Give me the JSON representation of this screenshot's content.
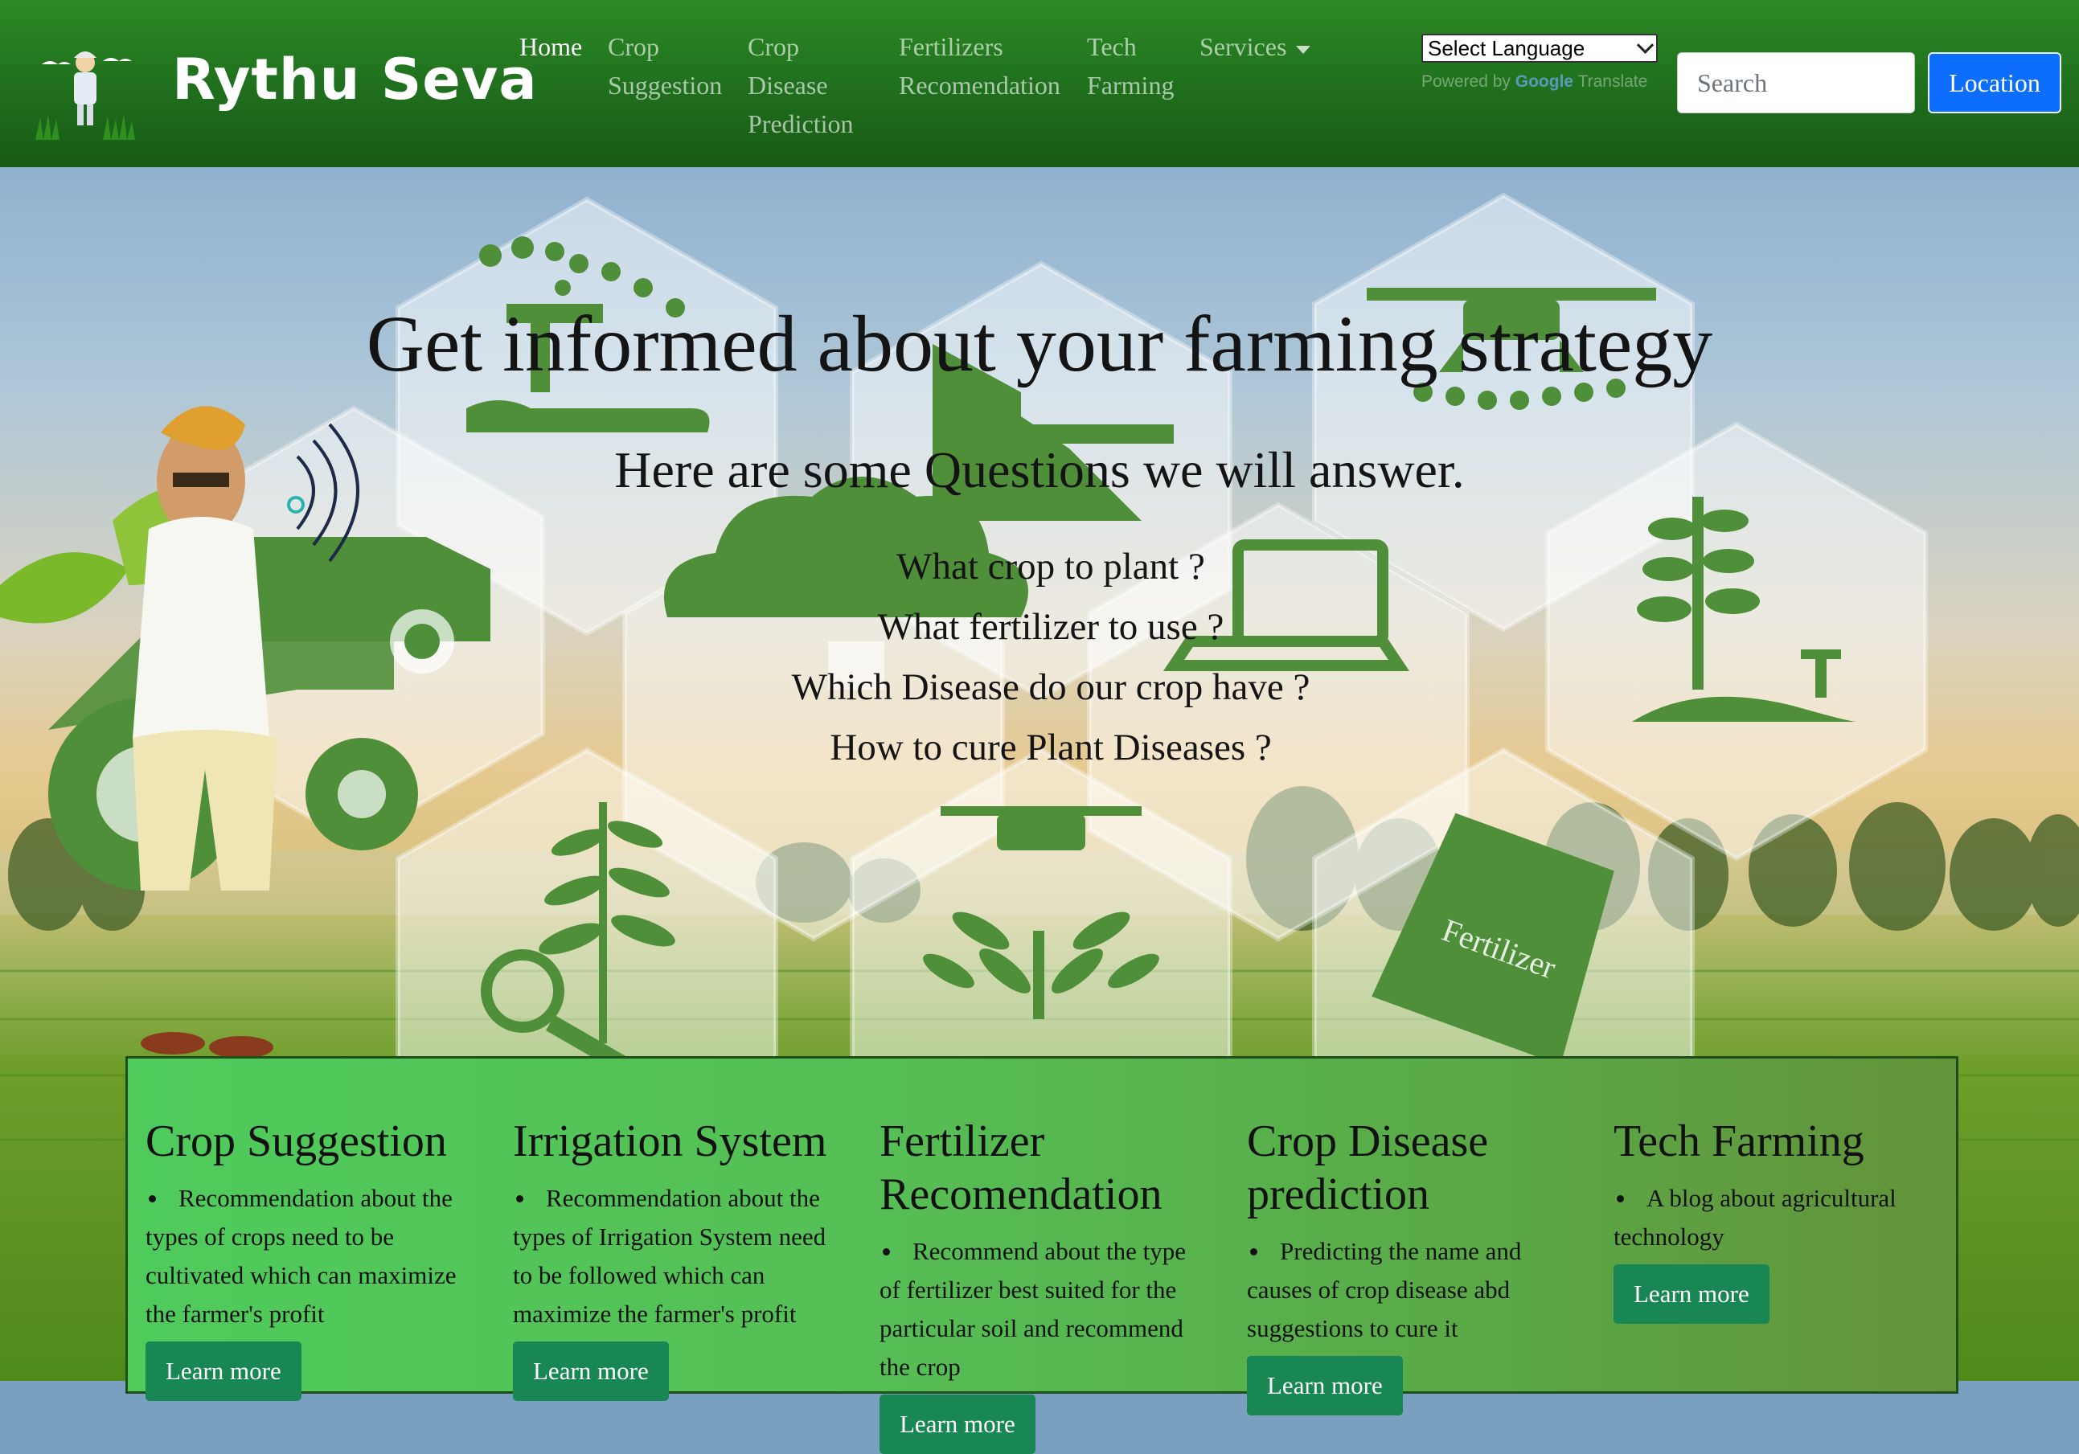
{
  "brand": {
    "name": "Rythu Seva"
  },
  "nav": {
    "items": [
      {
        "label": "Home",
        "lines": [
          "Home"
        ],
        "active": true
      },
      {
        "label": "Crop Suggestion",
        "lines": [
          "Crop",
          "Suggestion"
        ]
      },
      {
        "label": "Crop Disease Prediction",
        "lines": [
          "Crop",
          "Disease",
          "Prediction"
        ]
      },
      {
        "label": "Fertilizers Recomendation",
        "lines": [
          "Fertilizers",
          "Recomendation"
        ]
      },
      {
        "label": "Tech Farming",
        "lines": [
          "Tech",
          "Farming"
        ]
      },
      {
        "label": "Services",
        "lines": [
          "Services"
        ],
        "dropdown": true
      }
    ]
  },
  "language": {
    "selected": "Select Language",
    "powered_prefix": "Powered by",
    "powered_brand": "Google",
    "powered_suffix": "Translate"
  },
  "search": {
    "placeholder": "Search"
  },
  "location_button": "Location",
  "hero": {
    "headline": "Get informed about your farming strategy",
    "subheadline": "Here are some Questions we will answer.",
    "questions": [
      "What crop to plant ?",
      "What fertilizer to use ?",
      "Which Disease do our crop have ?",
      "How to cure Plant Diseases ?"
    ],
    "fertilizer_bag_text": "Fertilizer"
  },
  "services": [
    {
      "title": "Crop Suggestion",
      "description": "Recommendation about the types of crops need to be cultivated which can maximize the farmer's profit",
      "button": "Learn more"
    },
    {
      "title": "Irrigation System",
      "description": "Recommendation about the types of Irrigation System need to be followed which can maximize the farmer's profit",
      "button": "Learn more"
    },
    {
      "title": "Fertilizer Recomendation",
      "description": "Recommend about the type of fertilizer best suited for the particular soil and recommend the crop",
      "button": "Learn more"
    },
    {
      "title": "Crop Disease prediction",
      "description": "Predicting the name and causes of crop disease abd suggestions to cure it",
      "button": "Learn more"
    },
    {
      "title": "Tech Farming",
      "description": "A blog about agricultural technology",
      "button": "Learn more"
    }
  ],
  "colors": {
    "navbar": "#1f6e1d",
    "primary": "#0d6efd",
    "success": "#198754",
    "panel": "#55bf55",
    "icon_green": "#4f8f3a"
  }
}
